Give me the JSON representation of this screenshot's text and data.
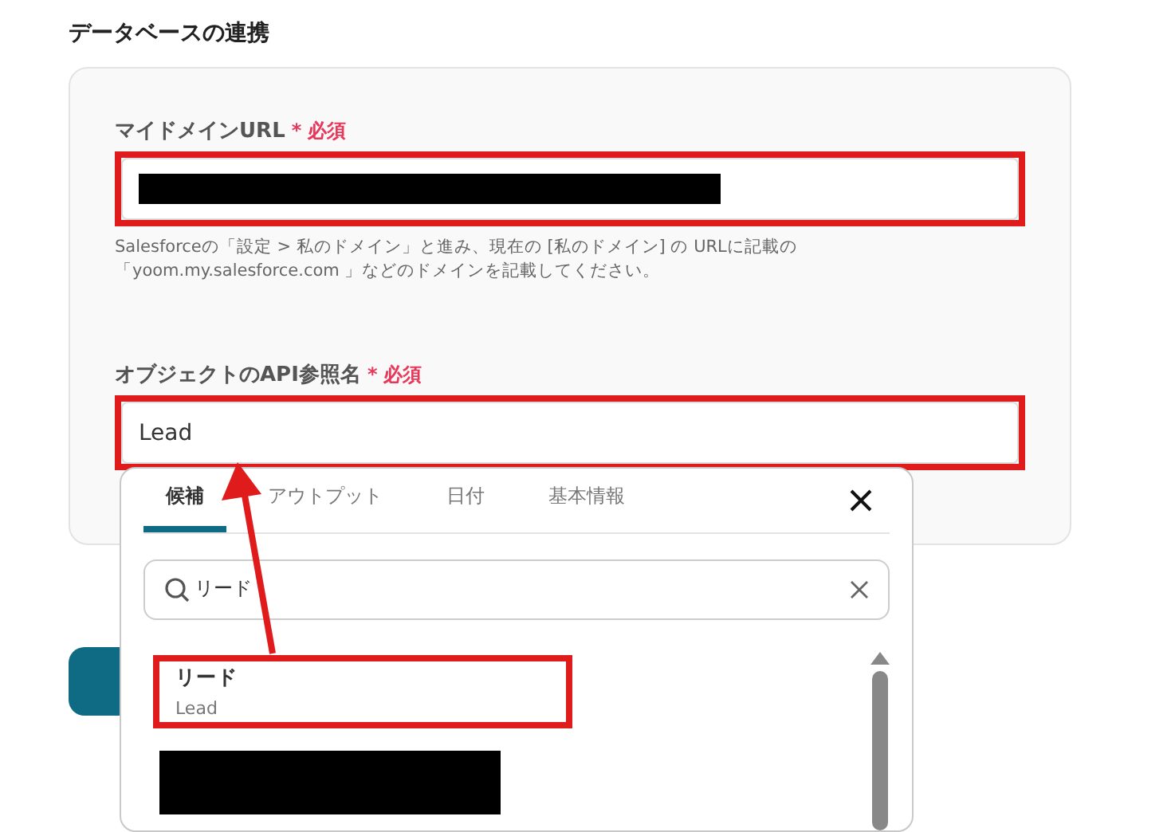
{
  "section_title": "データベースの連携",
  "fields": [
    {
      "label": "マイドメインURL",
      "required_mark": "*",
      "required": "必須",
      "redacted": true,
      "annotated": true,
      "help": [
        "Salesforceの「設定 > 私のドメイン」と進み、現在の [私のドメイン] の URLに記載の",
        "「yoom.my.salesforce.com 」などのドメインを記載してください。"
      ]
    },
    {
      "label": "オブジェクトのAPI参照名",
      "required_mark": "*",
      "required": "必須",
      "value": "Lead",
      "annotated": true
    }
  ],
  "popup": {
    "tabs": [
      {
        "label": "候補",
        "selected": true
      },
      {
        "label": "アウトプット",
        "selected": false
      },
      {
        "label": "日付",
        "selected": false
      },
      {
        "label": "基本情報",
        "selected": false
      }
    ],
    "search": {
      "value": "リード"
    },
    "items": [
      {
        "title": "リード",
        "subtitle": "Lead",
        "annotated": true
      },
      {
        "redacted": true,
        "annotated": false
      }
    ]
  }
}
